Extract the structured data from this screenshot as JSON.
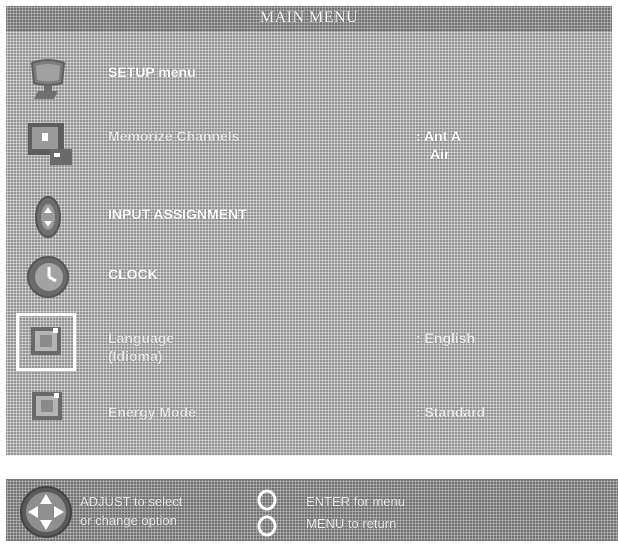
{
  "title": "MAIN MENU",
  "menu": {
    "items": [
      {
        "label": "SETUP menu",
        "value": "",
        "value2": "",
        "icon": "tv-setup-icon"
      },
      {
        "label": "Memorize Channels",
        "value": ": Ant A",
        "value2": "Air",
        "icon": "memorize-channels-icon"
      },
      {
        "label": "INPUT ASSIGNMENT",
        "value": "",
        "value2": "",
        "icon": "input-assignment-icon"
      },
      {
        "label": "CLOCK",
        "value": "",
        "value2": "",
        "icon": "clock-icon"
      },
      {
        "label": "Language",
        "label2": "(Idioma)",
        "value": ": English",
        "value2": "",
        "icon": "language-icon"
      },
      {
        "label": "Energy Mode",
        "value": ": Standard",
        "value2": "",
        "icon": "energy-mode-icon"
      }
    ],
    "selected_index": 4
  },
  "footer": {
    "adjust_line1": "ADJUST to select",
    "adjust_line2": "or change option",
    "enter_text": "ENTER for menu",
    "menu_text": "MENU to return"
  },
  "colors": {
    "panel": "#a9a9a9",
    "text": "#ffffff",
    "highlight_border": "#ffffff"
  }
}
